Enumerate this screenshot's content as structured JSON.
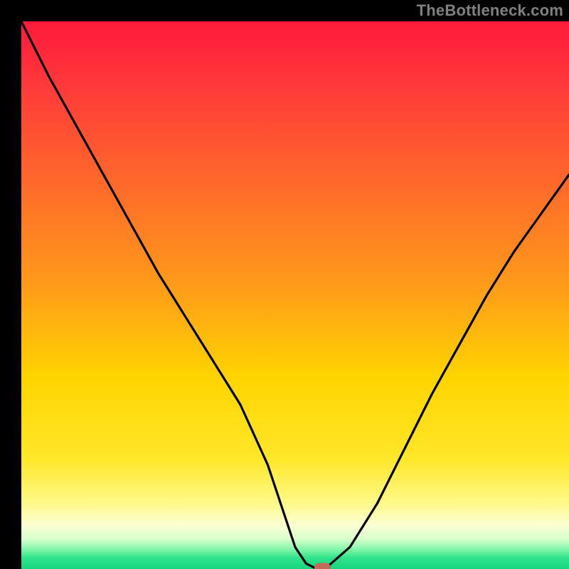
{
  "watermark": "TheBottleneck.com",
  "colors": {
    "curve": "#000000",
    "marker": "#c46a5a"
  },
  "chart_data": {
    "type": "line",
    "title": "",
    "xlabel": "",
    "ylabel": "",
    "xlim": [
      0,
      100
    ],
    "ylim": [
      0,
      100
    ],
    "grid": false,
    "legend": false,
    "series": [
      {
        "name": "bottleneck-curve",
        "x": [
          0,
          5,
          10,
          15,
          20,
          25,
          30,
          35,
          40,
          45,
          48,
          50,
          52,
          54,
          56,
          60,
          65,
          70,
          75,
          80,
          85,
          90,
          95,
          100
        ],
        "y": [
          100,
          90,
          81,
          72,
          63,
          54,
          46,
          38,
          30,
          19,
          10,
          4,
          1,
          0,
          0.5,
          4,
          12,
          22,
          32,
          41,
          50,
          58,
          65,
          72
        ]
      }
    ],
    "marker": {
      "x": 55,
      "y": 0,
      "w": 3.0,
      "h": 2.2
    }
  }
}
